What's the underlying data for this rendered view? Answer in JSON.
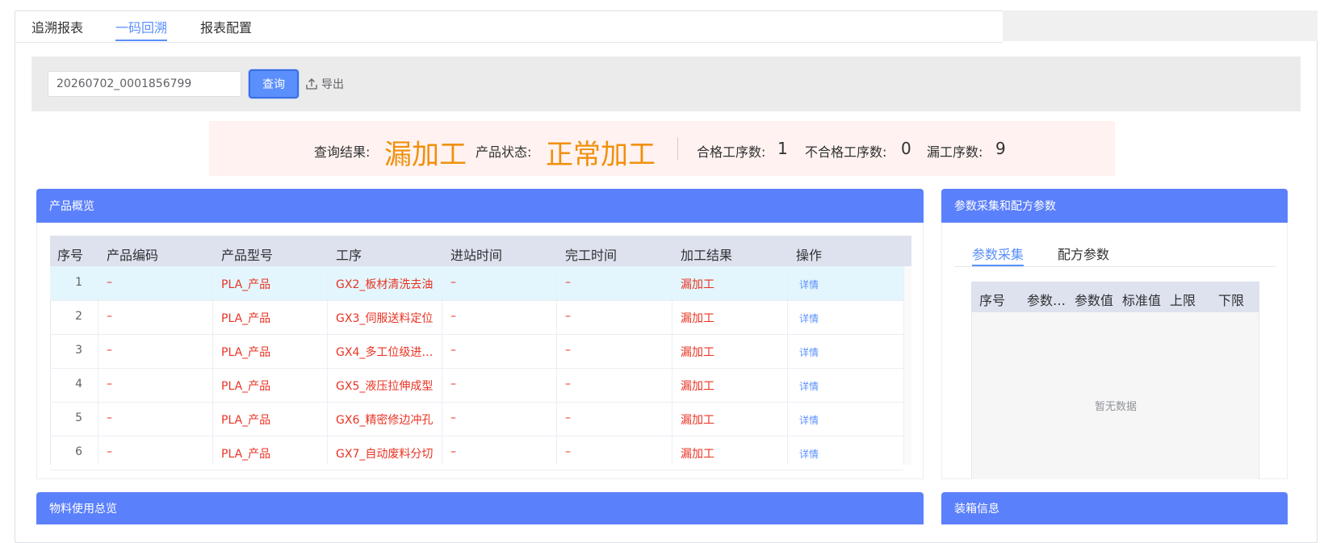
{
  "tabs": [
    "追溯报表",
    "一码回溯",
    "报表配置"
  ],
  "active_tab": "一码回溯",
  "query": {
    "input_value": "20260702_0001856799",
    "query_label": "查询",
    "export_label": "导出"
  },
  "summary": {
    "result_label": "查询结果:",
    "result_value": "漏加工",
    "status_label": "产品状态:",
    "status_value": "正常加工",
    "pass_label": "合格工序数:",
    "pass_value": "1",
    "fail_label": "不合格工序数:",
    "fail_value": "0",
    "missed_label": "漏工序数:",
    "missed_value": "9"
  },
  "overview": {
    "title": "产品概览",
    "columns": [
      "序号",
      "产品编码",
      "产品型号",
      "工序",
      "进站时间",
      "完工时间",
      "加工结果",
      "操作"
    ],
    "rows": [
      {
        "seq": "1",
        "code": "–",
        "model": "PLA_产品",
        "process": "GX2_板材清洗去油",
        "in_time": "–",
        "done_time": "–",
        "result": "漏加工",
        "action": "详情"
      },
      {
        "seq": "2",
        "code": "–",
        "model": "PLA_产品",
        "process": "GX3_伺服送料定位",
        "in_time": "–",
        "done_time": "–",
        "result": "漏加工",
        "action": "详情"
      },
      {
        "seq": "3",
        "code": "–",
        "model": "PLA_产品",
        "process": "GX4_多工位级进…",
        "in_time": "–",
        "done_time": "–",
        "result": "漏加工",
        "action": "详情"
      },
      {
        "seq": "4",
        "code": "–",
        "model": "PLA_产品",
        "process": "GX5_液压拉伸成型",
        "in_time": "–",
        "done_time": "–",
        "result": "漏加工",
        "action": "详情"
      },
      {
        "seq": "5",
        "code": "–",
        "model": "PLA_产品",
        "process": "GX6_精密修边冲孔",
        "in_time": "–",
        "done_time": "–",
        "result": "漏加工",
        "action": "详情"
      },
      {
        "seq": "6",
        "code": "–",
        "model": "PLA_产品",
        "process": "GX7_自动废料分切",
        "in_time": "–",
        "done_time": "–",
        "result": "漏加工",
        "action": "详情"
      }
    ]
  },
  "params": {
    "title": "参数采集和配方参数",
    "tabs": [
      "参数采集",
      "配方参数"
    ],
    "columns": [
      "序号",
      "参数…",
      "参数值",
      "标准值",
      "上限",
      "下限"
    ],
    "empty_text": "暂无数据"
  },
  "materials": {
    "title": "物料使用总览"
  },
  "packing": {
    "title": "装箱信息"
  },
  "colors": {
    "accent": "#5b8ffc",
    "panel_header": "#5b80fb",
    "orange": "#f0900c",
    "red": "#ea3323"
  },
  "icons": {
    "export": "upload-icon"
  }
}
